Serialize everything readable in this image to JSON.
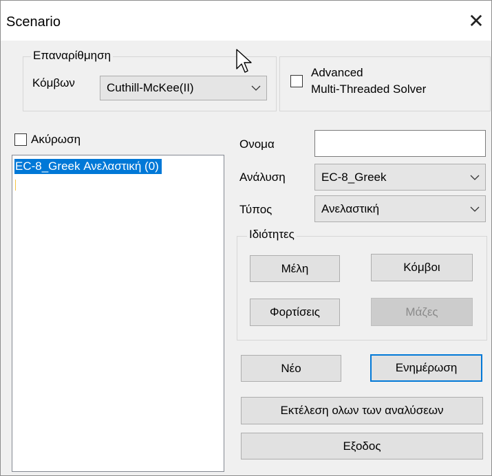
{
  "window": {
    "title": "Scenario",
    "close_symbol": "✕"
  },
  "renumbering": {
    "legend": "Επαναρίθμηση",
    "label": "Κόμβων",
    "selected": "Cuthill-McKee(II)"
  },
  "solver": {
    "line1": "Advanced",
    "line2": "Multi-Threaded Solver",
    "checked": false
  },
  "cancel": {
    "label": "Ακύρωση",
    "checked": false
  },
  "scenario_list": {
    "items": [
      "EC-8_Greek Ανελαστική (0)"
    ],
    "selected_index": 0
  },
  "form": {
    "name_label": "Ονομα",
    "name_value": "",
    "analysis_label": "Ανάλυση",
    "analysis_value": "EC-8_Greek",
    "type_label": "Τύπος",
    "type_value": "Ανελαστική"
  },
  "properties": {
    "legend": "Ιδιότητες",
    "members": "Μέλη",
    "nodes": "Κόμβοι",
    "loads": "Φορτίσεις",
    "masses": "Μάζες"
  },
  "actions": {
    "new": "Νέο",
    "update": "Ενημέρωση",
    "run_all": "Εκτέλεση ολων των αναλύσεων",
    "exit": "Εξοδος"
  },
  "colors": {
    "selection": "#0078d7",
    "dialog_bg": "#f0f0f0",
    "default_button_border": "#0078d7"
  }
}
